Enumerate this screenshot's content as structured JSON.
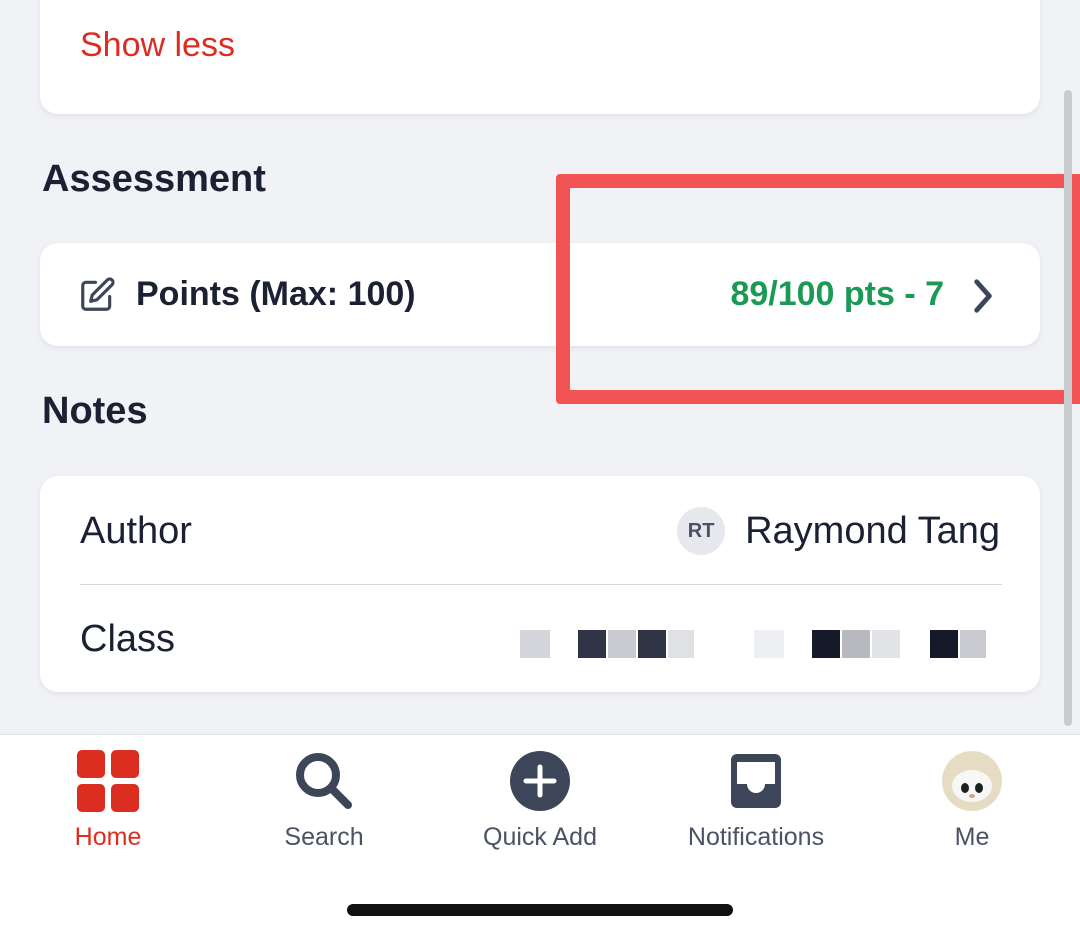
{
  "top_card": {
    "show_less_label": "Show less"
  },
  "assessment": {
    "heading": "Assessment",
    "points_label": "Points (Max: 100)",
    "points_value": "89/100 pts - 7"
  },
  "notes": {
    "heading": "Notes",
    "author_label": "Author",
    "author_initials": "RT",
    "author_name": "Raymond Tang",
    "class_label": "Class"
  },
  "tabbar": {
    "tabs": [
      {
        "label": "Home",
        "icon": "grid-icon",
        "active": true
      },
      {
        "label": "Search",
        "icon": "search-icon",
        "active": false
      },
      {
        "label": "Quick Add",
        "icon": "plus-circle-icon",
        "active": false
      },
      {
        "label": "Notifications",
        "icon": "inbox-icon",
        "active": false
      },
      {
        "label": "Me",
        "icon": "profile-avatar",
        "active": false
      }
    ]
  },
  "colors": {
    "accent": "#db2d20",
    "points_green": "#1a9a55",
    "highlight": "#f25456",
    "text_dark": "#1b2133",
    "icon_slate": "#3d4659"
  }
}
